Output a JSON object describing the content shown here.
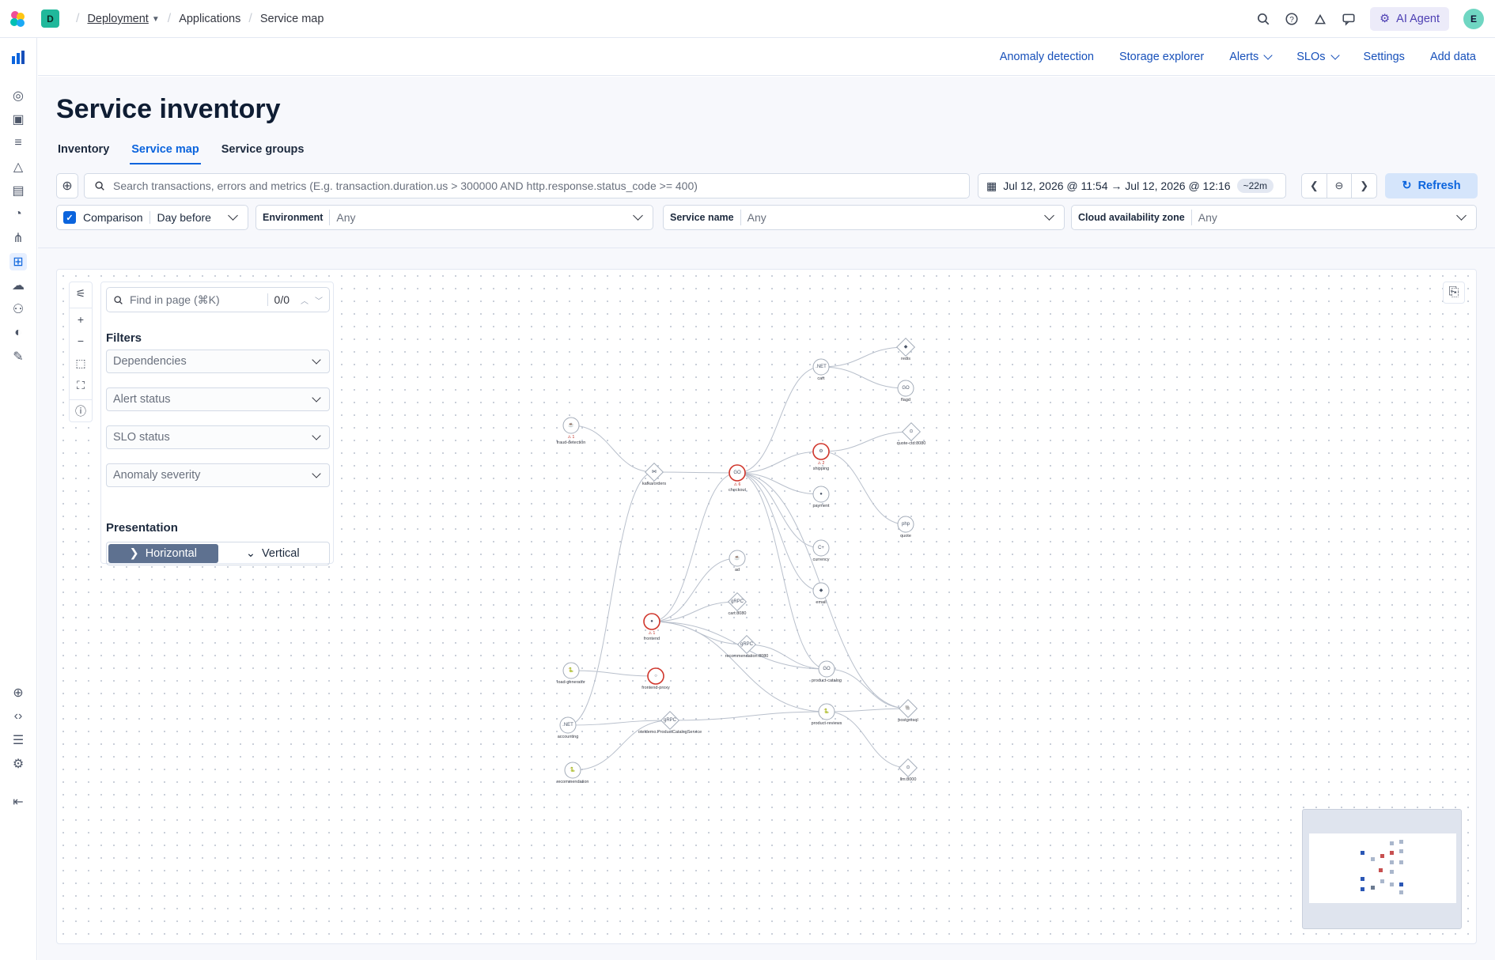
{
  "topbar": {
    "space_initial": "D",
    "breadcrumbs": [
      "Deployment",
      "Applications",
      "Service map"
    ],
    "ai_agent_label": "AI Agent",
    "avatar_initial": "E"
  },
  "subnav": {
    "anomaly": "Anomaly detection",
    "storage": "Storage explorer",
    "alerts": "Alerts",
    "slos": "SLOs",
    "settings": "Settings",
    "add_data": "Add data"
  },
  "page": {
    "title": "Service inventory",
    "tabs": [
      "Inventory",
      "Service map",
      "Service groups"
    ],
    "active_tab": "Service map"
  },
  "query": {
    "placeholder": "Search transactions, errors and metrics (E.g. transaction.duration.us > 300000 AND http.response.status_code >= 400)",
    "date_range": "Jul 12, 2026 @ 11:54 → Jul 12, 2026 @ 12:16",
    "duration": "~22m",
    "refresh_label": "Refresh"
  },
  "filters": {
    "comparison_label": "Comparison",
    "comparison_checked": true,
    "comparison_value": "Day before",
    "environment_label": "Environment",
    "environment_value": "Any",
    "service_name_label": "Service name",
    "service_name_value": "Any",
    "zone_label": "Cloud availability zone",
    "zone_value": "Any"
  },
  "map_panel": {
    "find_placeholder": "Find in page (⌘K)",
    "find_count": "0/0",
    "filters_heading": "Filters",
    "dropdowns": [
      "Dependencies",
      "Alert status",
      "SLO status",
      "Anomaly severity"
    ],
    "presentation_heading": "Presentation",
    "presentation_options": [
      "Horizontal",
      "Vertical"
    ],
    "presentation_selected": "Horizontal"
  },
  "graph": {
    "nodes": [
      {
        "id": "fraud-detection",
        "label": "fraud-detection",
        "kind": "service",
        "glyph": "java",
        "alert": "⚠ 1"
      },
      {
        "id": "kafka",
        "label": "kafka/orders",
        "kind": "dependency",
        "glyph": "kafka"
      },
      {
        "id": "checkout",
        "label": "checkout",
        "kind": "service",
        "glyph": "go",
        "alert": "⚠ 6",
        "ring": "red"
      },
      {
        "id": "cart",
        "label": "cart",
        "kind": "service",
        "glyph": ".NET"
      },
      {
        "id": "redis",
        "label": "redis",
        "kind": "dependency",
        "glyph": "redis"
      },
      {
        "id": "flagd",
        "label": "flagd",
        "kind": "service",
        "glyph": "go"
      },
      {
        "id": "shipping",
        "label": "shipping",
        "kind": "service",
        "glyph": "rust",
        "alert": "⚠ 2",
        "ring": "red"
      },
      {
        "id": "quote-ext",
        "label": "quote-ctd:8080",
        "kind": "dependency",
        "glyph": "http"
      },
      {
        "id": "payment",
        "label": "payment",
        "kind": "service",
        "glyph": "node"
      },
      {
        "id": "quote",
        "label": "quote",
        "kind": "service",
        "glyph": "php"
      },
      {
        "id": "currency",
        "label": "currency",
        "kind": "service",
        "glyph": "cpp"
      },
      {
        "id": "email",
        "label": "email",
        "kind": "service",
        "glyph": "ruby"
      },
      {
        "id": "ad",
        "label": "ad",
        "kind": "service",
        "glyph": "java"
      },
      {
        "id": "cart8080",
        "label": "cart:8080",
        "kind": "dependency",
        "glyph": "grpc"
      },
      {
        "id": "frontend",
        "label": "frontend",
        "kind": "service",
        "glyph": "node",
        "alert": "⚠ 1",
        "ring": "red"
      },
      {
        "id": "recommendation8080",
        "label": "recommendation:8080",
        "kind": "dependency",
        "glyph": "grpc"
      },
      {
        "id": "load-generator",
        "label": "load-generator",
        "kind": "service",
        "glyph": "python"
      },
      {
        "id": "frontend-proxy",
        "label": "frontend-proxy",
        "kind": "service",
        "glyph": "envoy",
        "ring": "red"
      },
      {
        "id": "product-catalog",
        "label": "product-catalog",
        "kind": "service",
        "glyph": "go"
      },
      {
        "id": "accounting",
        "label": "accounting",
        "kind": "service",
        "glyph": ".NET"
      },
      {
        "id": "otel-pcs",
        "label": "oteldemo.ProductCatalogService",
        "kind": "dependency",
        "glyph": "grpc"
      },
      {
        "id": "product-reviews",
        "label": "product-reviews",
        "kind": "service",
        "glyph": "python"
      },
      {
        "id": "postgresql",
        "label": "postgresql",
        "kind": "dependency",
        "glyph": "pg"
      },
      {
        "id": "recommendation",
        "label": "recommendation",
        "kind": "service",
        "glyph": "python"
      },
      {
        "id": "llm",
        "label": "llm:8000",
        "kind": "dependency",
        "glyph": "http"
      }
    ],
    "edges": [
      [
        "fraud-detection",
        "kafka"
      ],
      [
        "accounting",
        "kafka"
      ],
      [
        "kafka",
        "checkout"
      ],
      [
        "checkout",
        "cart"
      ],
      [
        "checkout",
        "shipping"
      ],
      [
        "checkout",
        "payment"
      ],
      [
        "checkout",
        "currency"
      ],
      [
        "checkout",
        "email"
      ],
      [
        "checkout",
        "product-catalog"
      ],
      [
        "checkout",
        "postgresql"
      ],
      [
        "cart",
        "redis"
      ],
      [
        "cart",
        "flagd"
      ],
      [
        "shipping",
        "quote-ext"
      ],
      [
        "shipping",
        "quote"
      ],
      [
        "frontend",
        "checkout"
      ],
      [
        "frontend",
        "ad"
      ],
      [
        "frontend",
        "cart8080"
      ],
      [
        "frontend",
        "recommendation8080"
      ],
      [
        "frontend",
        "product-catalog"
      ],
      [
        "frontend",
        "product-reviews"
      ],
      [
        "recommendation8080",
        "product-catalog"
      ],
      [
        "load-generator",
        "frontend-proxy"
      ],
      [
        "accounting",
        "otel-pcs"
      ],
      [
        "recommendation",
        "otel-pcs"
      ],
      [
        "otel-pcs",
        "product-reviews"
      ],
      [
        "product-catalog",
        "postgresql"
      ],
      [
        "product-reviews",
        "postgresql"
      ],
      [
        "product-reviews",
        "llm"
      ]
    ]
  }
}
